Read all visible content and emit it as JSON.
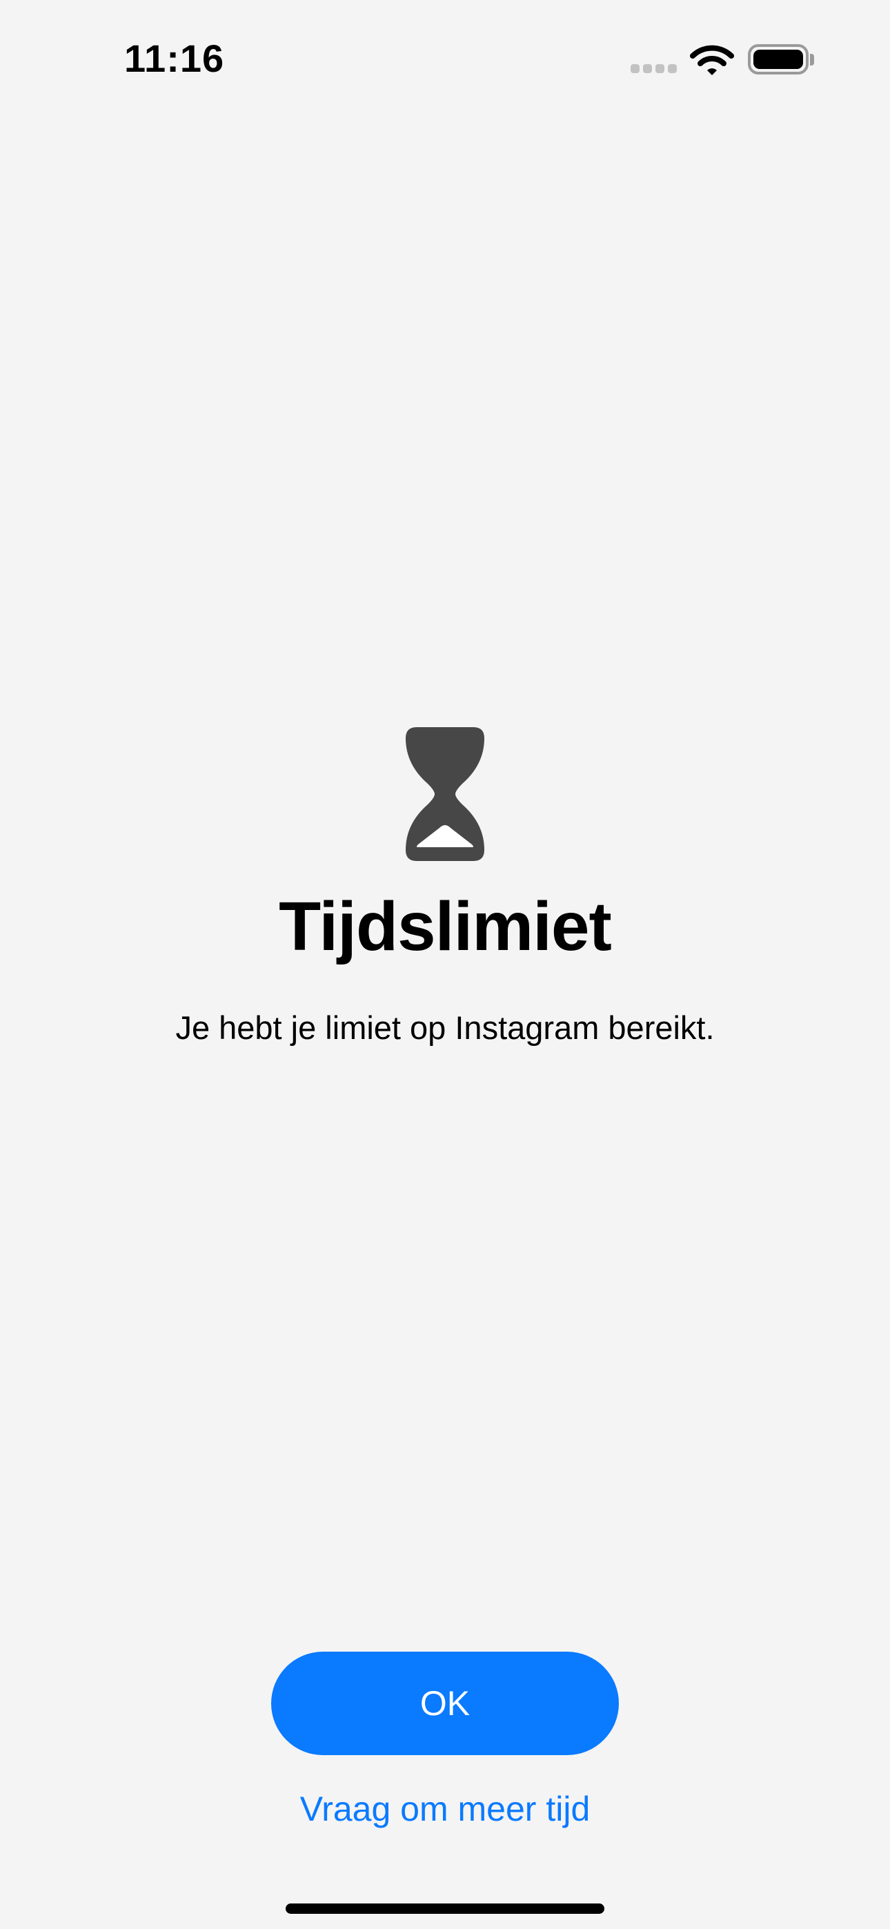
{
  "status_bar": {
    "time": "11:16",
    "icons": [
      "cellular-signal-icon",
      "wifi-icon",
      "battery-icon"
    ]
  },
  "icon": "hourglass-icon",
  "title": "Tijdslimiet",
  "message": "Je hebt je limiet op Instagram bereikt.",
  "buttons": {
    "ok_label": "OK",
    "more_time_label": "Vraag om meer tijd"
  },
  "colors": {
    "background": "#f4f4f4",
    "accent": "#0a7aff",
    "icon": "#474747"
  }
}
